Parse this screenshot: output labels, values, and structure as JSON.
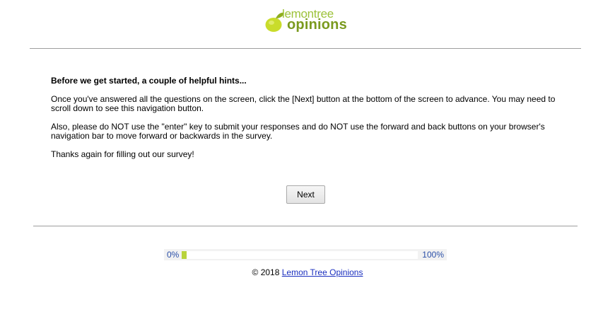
{
  "brand": {
    "logo_top": "lemontree",
    "logo_bottom": "opinions",
    "lemon_color": "#c9dc2b",
    "text_color": "#7a9a1e"
  },
  "hints": {
    "heading": "Before we get started, a couple of helpful hints...",
    "paragraph_1": "Once you've answered all the questions on the screen, click the [Next] button at the bottom of the screen to advance. You may need to scroll down to see this navigation button.",
    "paragraph_2": "Also, please do NOT use the \"enter\" key to submit your responses and do NOT use the forward and back buttons on your browser's navigation bar to move forward or backwards in the survey.",
    "paragraph_3": "Thanks again for filling out our survey!"
  },
  "navigation": {
    "next_label": "Next"
  },
  "progress": {
    "start_label": "0%",
    "end_label": "100%",
    "value_fraction": 0.02,
    "fill_color": "#b8d33c"
  },
  "footer": {
    "copyright": "© 2018",
    "link_text": "Lemon Tree Opinions"
  }
}
